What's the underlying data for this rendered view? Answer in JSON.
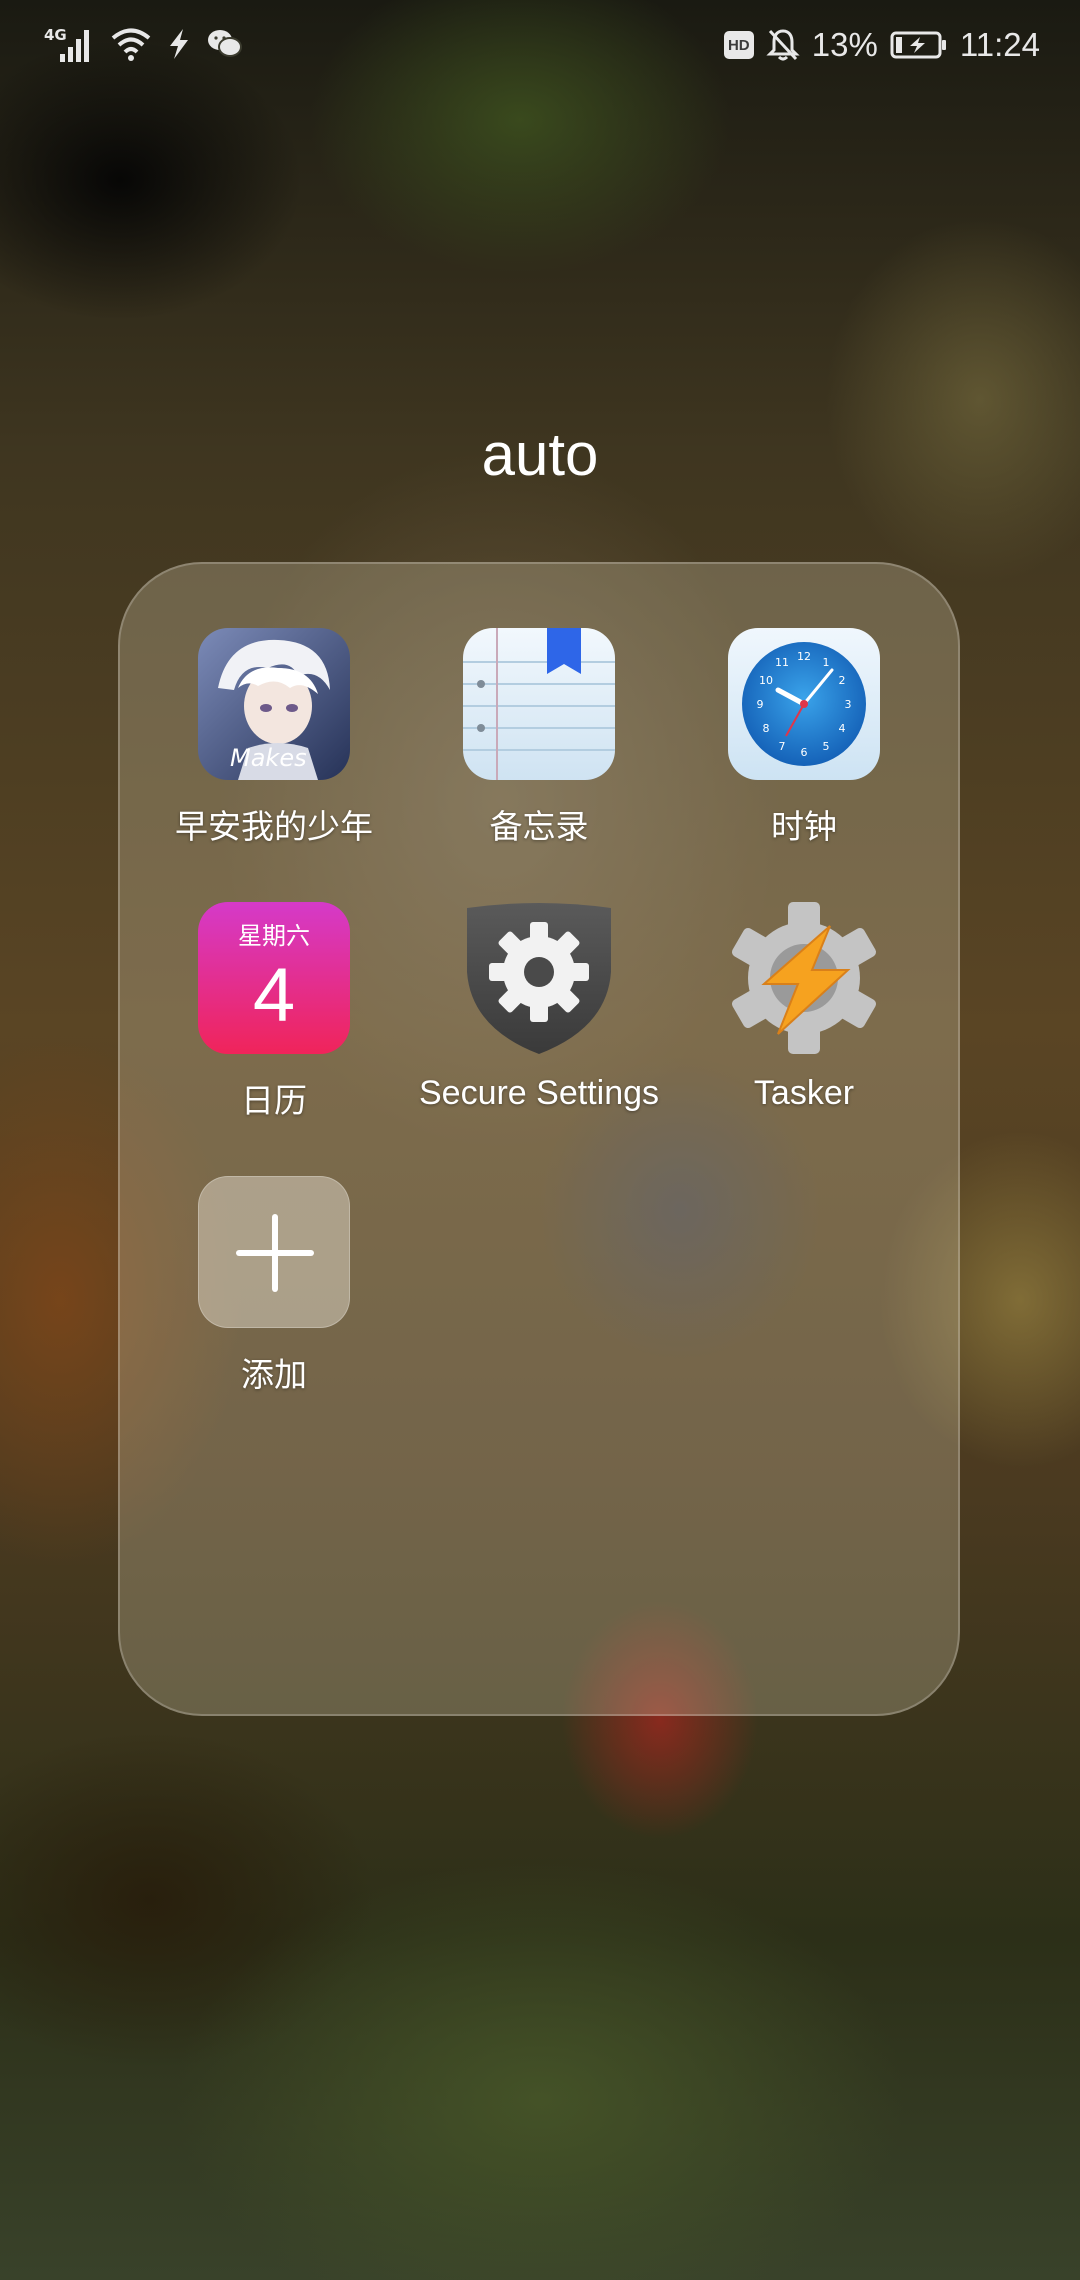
{
  "status_bar": {
    "network_type": "4G",
    "battery_percent": "13%",
    "hd_badge": "HD",
    "time": "11:24",
    "icons_left": [
      "signal-icon",
      "wifi-icon",
      "charging-bolt-icon",
      "wechat-icon"
    ],
    "icons_right": [
      "hd-icon",
      "bell-muted-icon",
      "battery-icon"
    ]
  },
  "folder": {
    "title": "auto",
    "apps": [
      {
        "label": "早安我的少年",
        "icon": "anime-game-icon"
      },
      {
        "label": "备忘录",
        "icon": "notepad-icon"
      },
      {
        "label": "时钟",
        "icon": "clock-icon"
      },
      {
        "label": "日历",
        "icon": "calendar-icon",
        "calendar_weekday": "星期六",
        "calendar_day": "4"
      },
      {
        "label": "Secure Settings",
        "icon": "secure-settings-icon"
      },
      {
        "label": "Tasker",
        "icon": "tasker-icon"
      },
      {
        "label": "添加",
        "icon": "add-icon"
      }
    ]
  },
  "colors": {
    "calendar_gradient_top": "#d53ac9",
    "calendar_gradient_bottom": "#f0245a",
    "clock_face": "#1f86d6",
    "notepad_bookmark": "#2e66e8",
    "tasker_bolt": "#f6a21f"
  }
}
